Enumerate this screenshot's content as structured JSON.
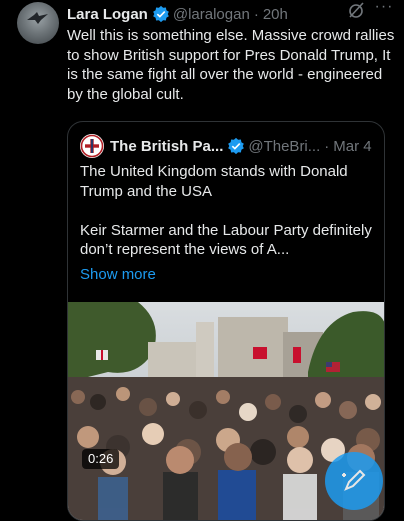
{
  "tweet": {
    "author_name": "Lara Logan",
    "handle": "@laralogan",
    "separator": "·",
    "time": "20h",
    "text": "Well this is something else. Massive crowd rallies to show British support for Pres Donald Trump, It is the same fight all over the world - engineered by the global cult.",
    "more_glyph": "···"
  },
  "quoted": {
    "author_name": "The British Pa...",
    "handle": "@TheBri...",
    "separator": "·",
    "time": "Mar 4",
    "para1": "The United Kingdom stands with Donald Trump and the USA",
    "para2": "Keir Starmer and the Labour Party definitely don’t represent the views of A...",
    "show_more": "Show more",
    "video_duration": "0:26"
  },
  "colors": {
    "background": "#000000",
    "text_primary": "#e7e9ea",
    "text_secondary": "#71767b",
    "accent": "#1d9bf0",
    "border": "#2f3336"
  },
  "icons": [
    "verified-badge-icon",
    "grok-icon",
    "more-options-icon",
    "play-icon",
    "compose-icon"
  ]
}
